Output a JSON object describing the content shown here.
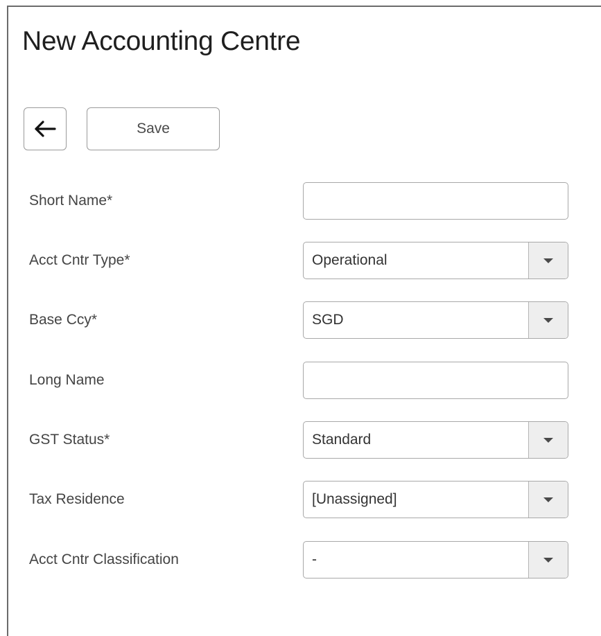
{
  "header": {
    "title": "New Accounting Centre"
  },
  "toolbar": {
    "back_icon": "arrow-left-icon",
    "save_label": "Save"
  },
  "form": {
    "short_name": {
      "label": "Short Name*",
      "value": "",
      "placeholder": ""
    },
    "acct_cntr_type": {
      "label": "Acct Cntr Type*",
      "value": "Operational"
    },
    "base_ccy": {
      "label": "Base Ccy*",
      "value": "SGD"
    },
    "long_name": {
      "label": "Long Name",
      "value": "",
      "placeholder": ""
    },
    "gst_status": {
      "label": "GST Status*",
      "value": "Standard"
    },
    "tax_residence": {
      "label": "Tax Residence",
      "value": "[Unassigned]"
    },
    "acct_cntr_classification": {
      "label": "Acct Cntr Classification",
      "value": "-"
    }
  },
  "colors": {
    "border": "#a8a8a8",
    "dropdown_bg": "#eeeeee",
    "text": "#333333"
  }
}
